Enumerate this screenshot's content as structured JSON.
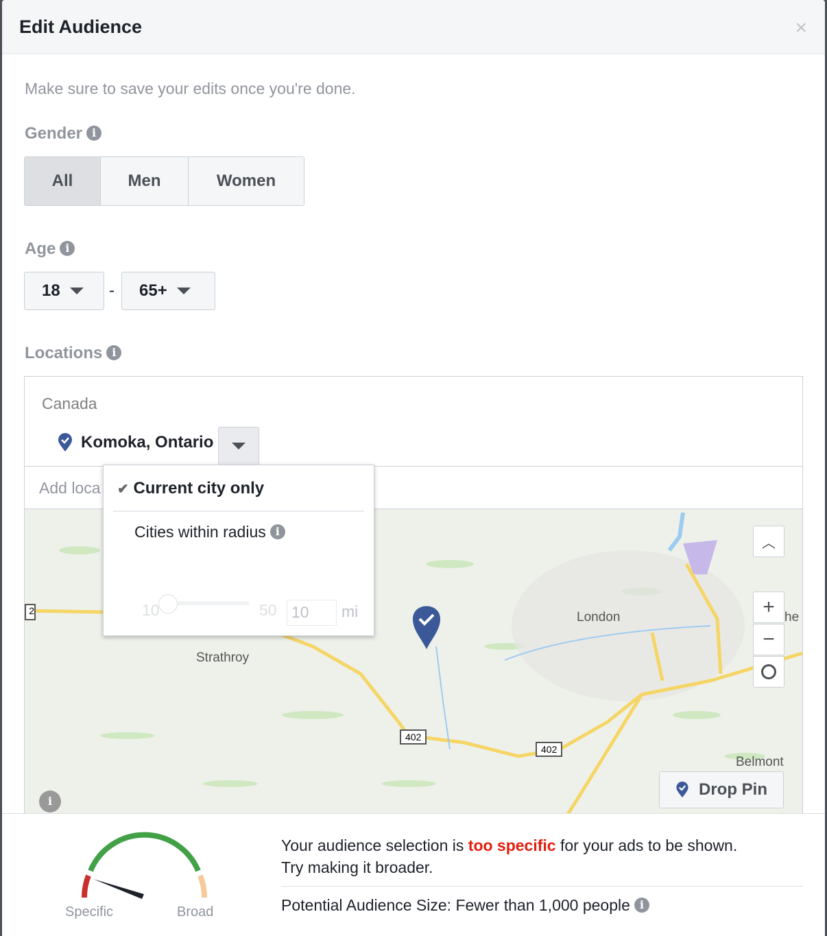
{
  "header": {
    "title": "Edit Audience",
    "close": "×"
  },
  "note": "Make sure to save your edits once you're done.",
  "gender": {
    "label": "Gender",
    "options": [
      "All",
      "Men",
      "Women"
    ],
    "selected": "All"
  },
  "age": {
    "label": "Age",
    "min": "18",
    "separator": "-",
    "max": "65+"
  },
  "locations": {
    "label": "Locations",
    "country": "Canada",
    "location": "Komoka, Ontario",
    "add_placeholder": "Add locations",
    "dropdown": {
      "option1": "Current city only",
      "option2": "Cities within radius",
      "check": "✔",
      "slider_min": "10",
      "slider_max": "50",
      "radius_value": "10",
      "unit": "mi",
      "radius_fraction": 0
    },
    "map": {
      "labels": {
        "london": "London",
        "strathroy": "Strathroy",
        "belmont": "Belmont",
        "hwy1": "402",
        "hwy2": "402",
        "edge_left": "2",
        "edge_right": "he"
      },
      "drop_pin": "Drop Pin",
      "zoom_in": "+",
      "zoom_out": "−"
    }
  },
  "footer": {
    "msg_pre": "Your audience selection is ",
    "msg_em": "too specific",
    "msg_post": " for your ads to be shown.",
    "msg2": "Try making it broader.",
    "size": "Potential Audience Size: Fewer than 1,000 people",
    "gauge_left": "Specific",
    "gauge_right": "Broad",
    "gauge_level": 0.1,
    "colors": {
      "specific": "#c9302c",
      "good": "#42a047",
      "broad": "#f7c99a",
      "warn": "#e41e0f"
    }
  }
}
